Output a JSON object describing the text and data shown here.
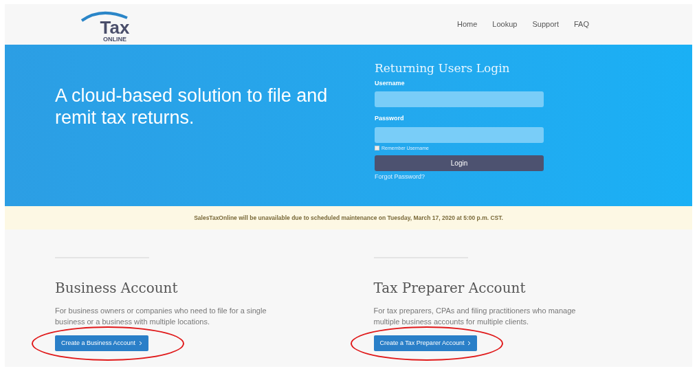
{
  "logo": {
    "word": "Tax",
    "sub": "ONLINE"
  },
  "nav": [
    "Home",
    "Lookup",
    "Support",
    "FAQ"
  ],
  "hero": {
    "headline": "A cloud-based solution to file and remit tax returns."
  },
  "login": {
    "title": "Returning Users Login",
    "fields": [
      {
        "label": "Username"
      },
      {
        "label": "Password"
      }
    ],
    "remember": {
      "label": "Remember Username",
      "checked": false
    },
    "button": "Login",
    "forgot": "Forgot Password?"
  },
  "notice": "SalesTaxOnline will be unavailable due to scheduled maintenance on Tuesday, March 17, 2020 at 5:00 p.m. CST.",
  "accounts": [
    {
      "title": "Business Account",
      "text": "For business owners or companies who need to file for a single business or a business with multiple locations.",
      "button": "Create a Business Account",
      "circled": true
    },
    {
      "title": "Tax Preparer Account",
      "text": "For tax preparers, CPAs and filing practitioners who manage multiple business accounts for multiple clients.",
      "button": "Create a Tax Preparer Account",
      "circled": true
    }
  ]
}
